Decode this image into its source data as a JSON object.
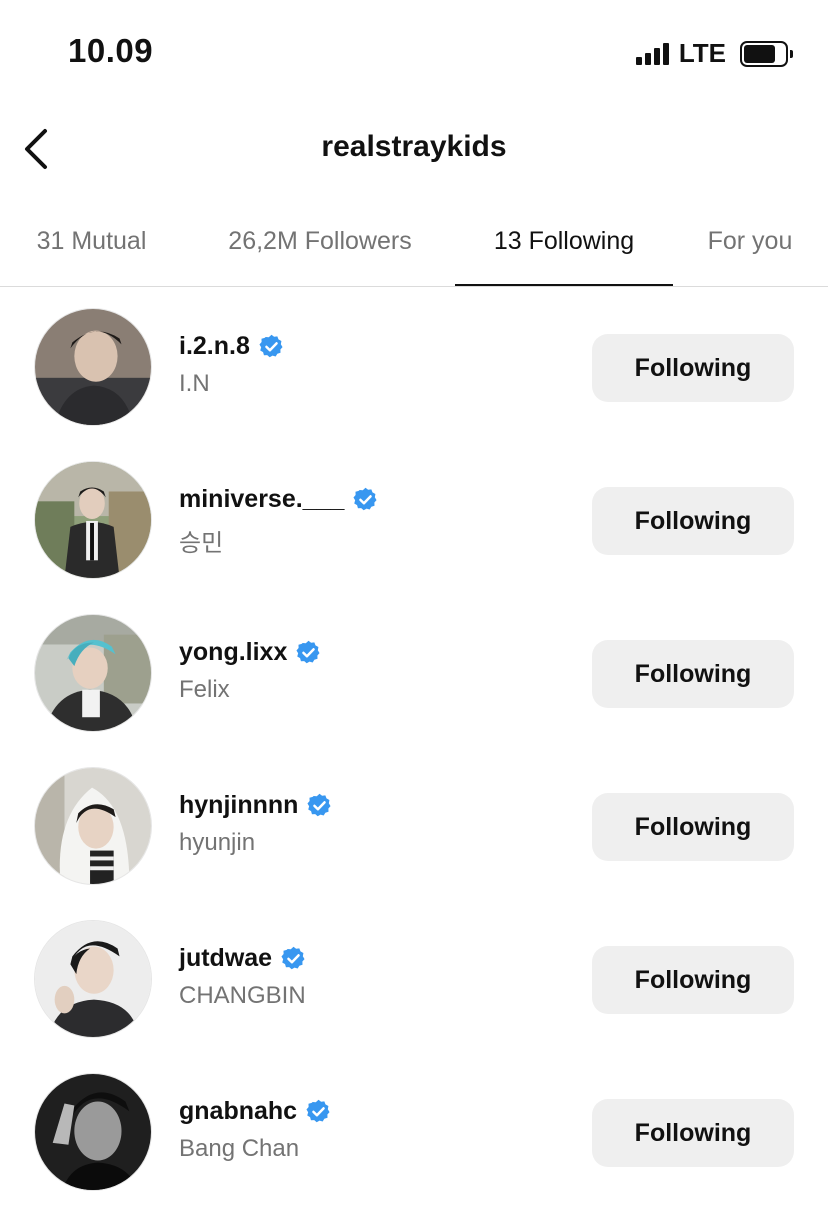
{
  "status_bar": {
    "time": "10.09",
    "network": "LTE",
    "icons": [
      "signal-icon",
      "battery-icon"
    ]
  },
  "header": {
    "title": "realstraykids",
    "back_icon": "chevron-left-icon"
  },
  "tabs": [
    {
      "label": "31 Mutual",
      "active": false
    },
    {
      "label": "26,2M Followers",
      "active": false
    },
    {
      "label": "13 Following",
      "active": true
    },
    {
      "label": "For you",
      "active": false
    }
  ],
  "accounts": [
    {
      "username": "i.2.n.8",
      "full_name": "I.N",
      "verified": true,
      "button": "Following"
    },
    {
      "username": "miniverse.___",
      "full_name": "승민",
      "verified": true,
      "button": "Following"
    },
    {
      "username": "yong.lixx",
      "full_name": "Felix",
      "verified": true,
      "button": "Following"
    },
    {
      "username": "hynjinnnn",
      "full_name": "hyunjin",
      "verified": true,
      "button": "Following"
    },
    {
      "username": "jutdwae",
      "full_name": "CHANGBIN",
      "verified": true,
      "button": "Following"
    },
    {
      "username": "gnabnahc",
      "full_name": "Bang Chan",
      "verified": true,
      "button": "Following"
    }
  ],
  "colors": {
    "verified_badge": "#3897f0",
    "button_bg": "#efefef",
    "secondary_text": "#737373"
  }
}
